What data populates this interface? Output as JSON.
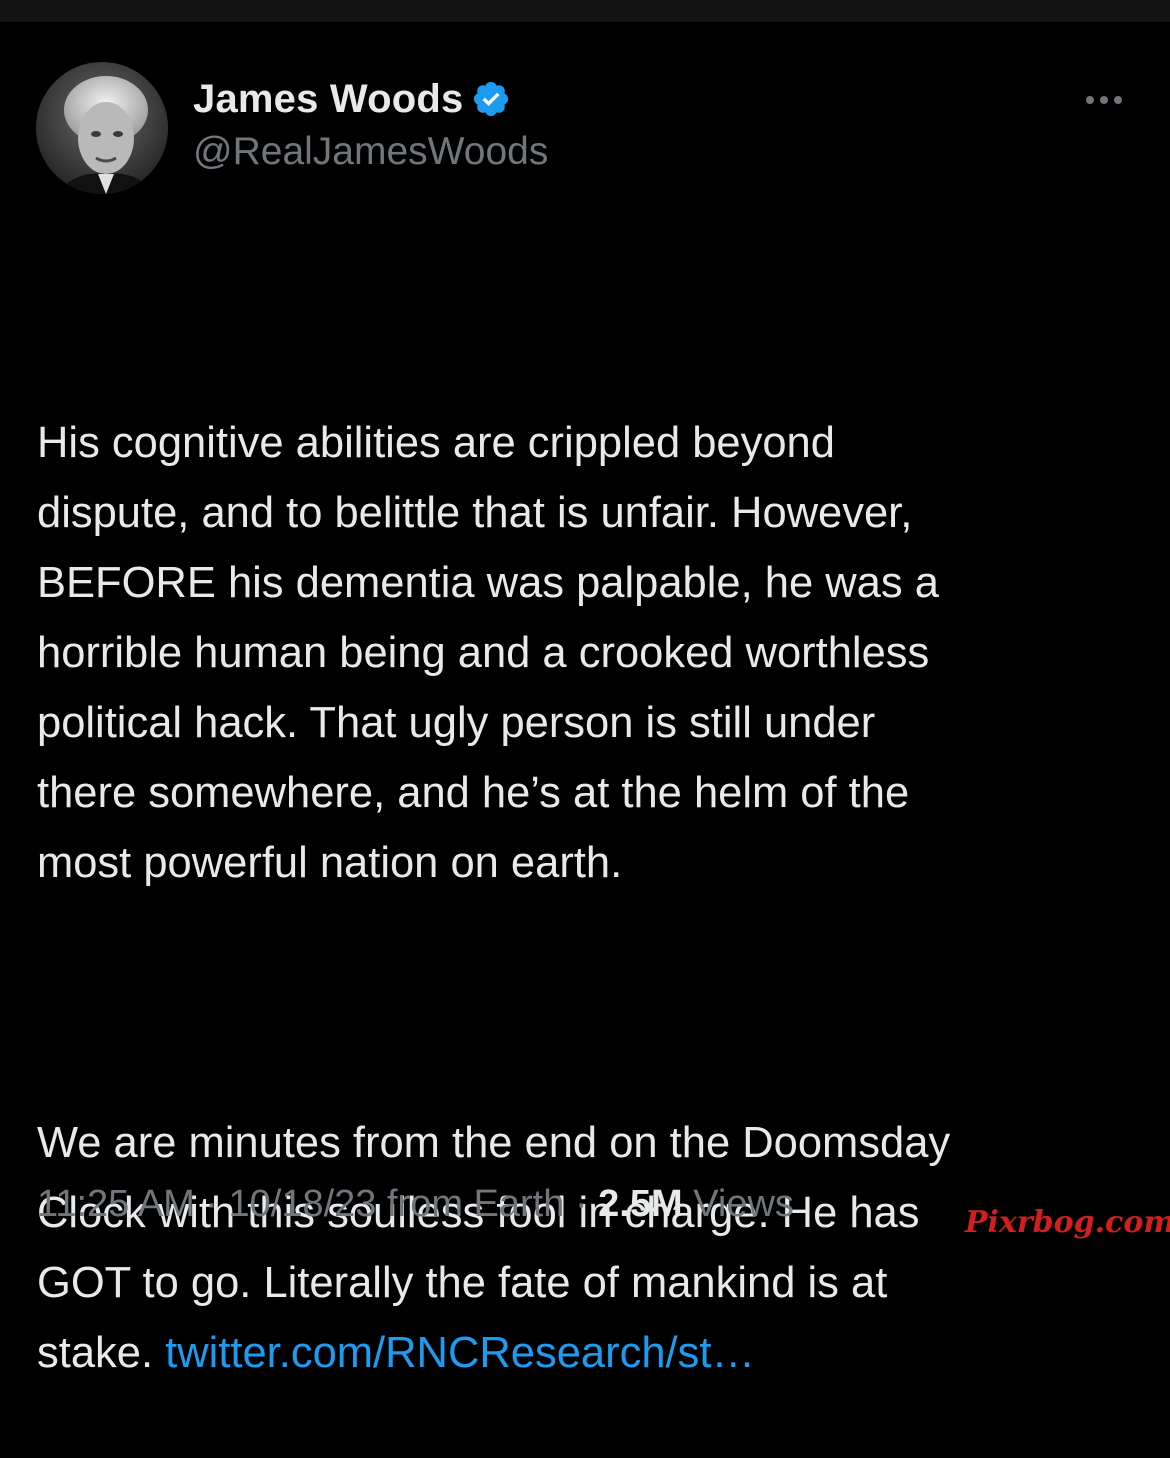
{
  "tweet": {
    "author": {
      "display_name": "James Woods",
      "handle": "@RealJamesWoods",
      "verified": true,
      "verified_color": "#1d9bf0"
    },
    "text": {
      "paragraph_1": "His cognitive abilities are crippled beyond\ndispute, and to belittle that is unfair. However,\nBEFORE his dementia was palpable, he was a\nhorrible human being and a crooked worthless\npolitical hack. That ugly person is still under\nthere somewhere, and he’s at the helm of the\nmost powerful nation on earth.",
      "paragraph_2_text": "We are minutes from the end on the Doomsday\nClock with this soulless fool in charge. He has\nGOT to go. Literally the fate of mankind is at\nstake. ",
      "link_text": "twitter.com/RNCResearch/st…",
      "link_color": "#1d9bf0"
    },
    "meta": {
      "time": "11:25 AM",
      "separator": " · ",
      "date": "10/18/23",
      "source": " from Earth",
      "views_count": "2.5M",
      "views_label": " Views"
    }
  },
  "watermark": "Pixrbog.com",
  "icons": {
    "more": "more-horizontal-icon",
    "verified": "verified-badge-icon",
    "avatar": "avatar-photo"
  },
  "colors": {
    "background": "#000000",
    "primary_text": "#e7e9ea",
    "secondary_text": "#71767b",
    "watermark": "#d21e1e"
  }
}
